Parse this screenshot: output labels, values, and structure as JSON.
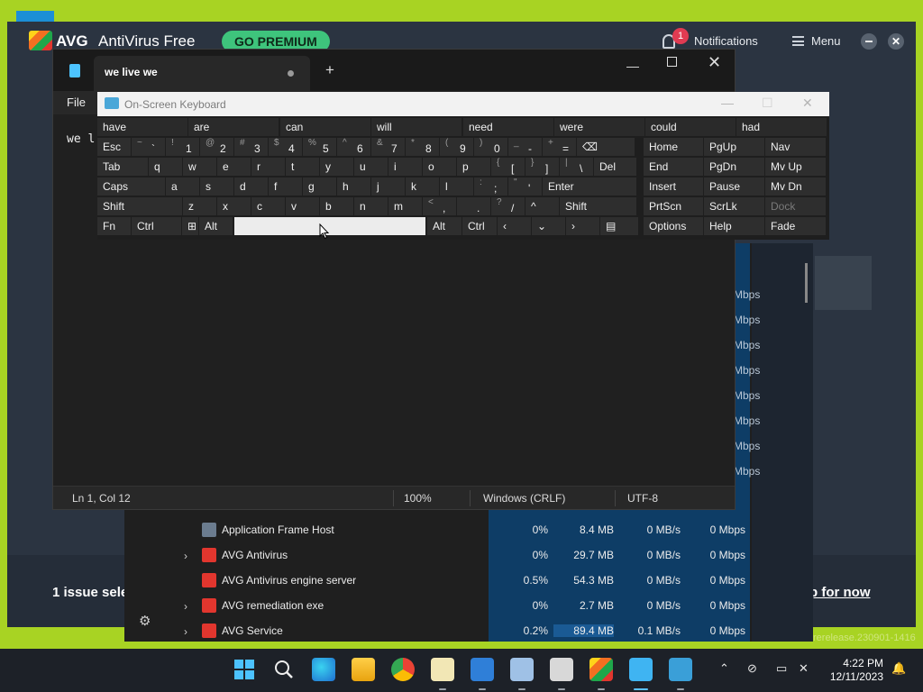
{
  "avg": {
    "brand": "AVG",
    "product": "AntiVirus Free",
    "premium_button": "GO PREMIUM",
    "notification_count": "1",
    "notifications_label": "Notifications",
    "menu_label": "Menu",
    "close_glyph": "✕",
    "issue_text": "1 issue sele",
    "fix_link": "p for now",
    "release": "rerelease.230901-1416",
    "colors": {
      "background": "#2b3441",
      "premium": "#3ec47c",
      "badge": "#e03b52"
    }
  },
  "task_manager": {
    "rows": [
      {
        "name": "Application Frame Host",
        "cpu": "0%",
        "memory": "8.4 MB",
        "disk": "0 MB/s",
        "network": "0 Mbps",
        "expandable": false
      },
      {
        "name": "AVG Antivirus",
        "cpu": "0%",
        "memory": "29.7 MB",
        "disk": "0 MB/s",
        "network": "0 Mbps",
        "expandable": true
      },
      {
        "name": "AVG Antivirus engine server",
        "cpu": "0.5%",
        "memory": "54.3 MB",
        "disk": "0 MB/s",
        "network": "0 Mbps",
        "expandable": false
      },
      {
        "name": "AVG remediation exe",
        "cpu": "0%",
        "memory": "2.7 MB",
        "disk": "0 MB/s",
        "network": "0 Mbps",
        "expandable": true
      },
      {
        "name": "AVG Service",
        "cpu": "0.2%",
        "memory": "89.4 MB",
        "disk": "0.1 MB/s",
        "network": "0 Mbps",
        "expandable": true
      }
    ],
    "side_values": [
      "Mbps",
      "Mbps",
      "Mbps",
      "Mbps",
      "Mbps",
      "Mbps",
      "Mbps",
      "Mbps"
    ],
    "settings_icon": "⚙",
    "expand_glyph": "›"
  },
  "notepad": {
    "tab_title": "we live we",
    "new_tab_glyph": "+",
    "min_glyph": "—",
    "close_glyph": "✕",
    "menu_file": "File",
    "content": "we l",
    "status": {
      "position": "Ln 1, Col 12",
      "zoom": "100%",
      "line_ending": "Windows (CRLF)",
      "encoding": "UTF-8"
    }
  },
  "keyboard": {
    "title": "On-Screen Keyboard",
    "title_buttons": {
      "minimize": "—",
      "maximize": "☐",
      "close": "✕"
    },
    "predictions": [
      "have",
      "are",
      "can",
      "will",
      "need",
      "were",
      "could",
      "had"
    ],
    "row1": [
      {
        "label": "Esc"
      },
      {
        "shift": "~",
        "main": "`"
      },
      {
        "shift": "!",
        "main": "1"
      },
      {
        "shift": "@",
        "main": "2"
      },
      {
        "shift": "#",
        "main": "3"
      },
      {
        "shift": "$",
        "main": "4"
      },
      {
        "shift": "%",
        "main": "5"
      },
      {
        "shift": "^",
        "main": "6"
      },
      {
        "shift": "&",
        "main": "7"
      },
      {
        "shift": "*",
        "main": "8"
      },
      {
        "shift": "(",
        "main": "9"
      },
      {
        "shift": ")",
        "main": "0"
      },
      {
        "shift": "_",
        "main": "-"
      },
      {
        "shift": "+",
        "main": "="
      },
      {
        "label": "⌫"
      }
    ],
    "row2": [
      "Tab",
      "q",
      "w",
      "e",
      "r",
      "t",
      "y",
      "u",
      "i",
      "o",
      "p",
      "[",
      "]",
      "\\",
      "Del"
    ],
    "row2_shift": {
      "[": "{",
      "]": "}",
      "\\": "|"
    },
    "row3": [
      "Caps",
      "a",
      "s",
      "d",
      "f",
      "g",
      "h",
      "j",
      "k",
      "l",
      ";",
      "'",
      "Enter"
    ],
    "row3_shift": {
      ";": ":",
      "'": "\""
    },
    "row4": [
      "Shift",
      "z",
      "x",
      "c",
      "v",
      "b",
      "n",
      "m",
      ",",
      ".",
      "/",
      "^",
      "Shift"
    ],
    "row4_shift": {
      ",": "<",
      ".": ">",
      "/": "?"
    },
    "row5": [
      "Fn",
      "Ctrl",
      "⊞",
      "Alt",
      "",
      "Alt",
      "Ctrl",
      "‹",
      "⌄",
      "›",
      "▤"
    ],
    "nav": [
      [
        "Home",
        "PgUp",
        "Nav"
      ],
      [
        "End",
        "PgDn",
        "Mv Up"
      ],
      [
        "Insert",
        "Pause",
        "Mv Dn"
      ],
      [
        "PrtScn",
        "ScrLk",
        "Dock"
      ],
      [
        "Options",
        "Help",
        "Fade"
      ]
    ]
  },
  "taskbar": {
    "time": "4:22 PM",
    "date": "12/11/2023",
    "tray_chevron": "⌃"
  }
}
